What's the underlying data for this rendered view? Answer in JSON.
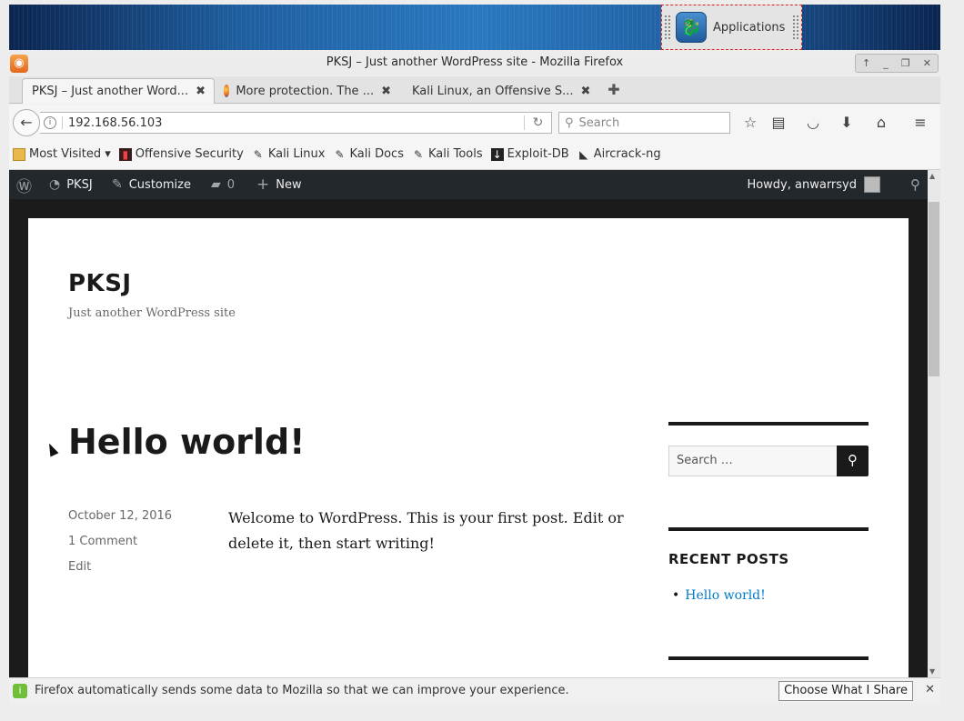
{
  "desktop": {
    "apps_label": "Applications"
  },
  "window": {
    "title": "PKSJ – Just another WordPress site - Mozilla Firefox",
    "controls": [
      "↑",
      "_",
      "❐",
      "✕"
    ]
  },
  "tabs": [
    {
      "label": "PKSJ – Just another Word...",
      "active": true
    },
    {
      "label": "More protection. The ...",
      "active": false
    },
    {
      "label": "Kali Linux, an Offensive S...",
      "active": false
    }
  ],
  "navbar": {
    "url": "192.168.56.103",
    "search_placeholder": "Search"
  },
  "bookmarks": [
    {
      "label": "Most Visited ▾",
      "icon": "folder-icon"
    },
    {
      "label": "Offensive Security",
      "icon": "offsec-icon"
    },
    {
      "label": "Kali Linux",
      "icon": "kali-icon"
    },
    {
      "label": "Kali Docs",
      "icon": "kali-icon"
    },
    {
      "label": "Kali Tools",
      "icon": "kali-icon"
    },
    {
      "label": "Exploit-DB",
      "icon": "exploitdb-icon"
    },
    {
      "label": "Aircrack-ng",
      "icon": "aircrack-icon"
    }
  ],
  "wpbar": {
    "site": "PKSJ",
    "customize": "Customize",
    "comments_count": "0",
    "new": "New",
    "howdy": "Howdy, anwarrsyd"
  },
  "site": {
    "title": "PKSJ",
    "description": "Just another WordPress site"
  },
  "post": {
    "title": "Hello world!",
    "date": "October 12, 2016",
    "comments": "1 Comment",
    "edit": "Edit",
    "body": "Welcome to WordPress. This is your first post. Edit or delete it, then start writing!"
  },
  "sidebar": {
    "search_placeholder": "Search …",
    "recent_posts_title": "RECENT POSTS",
    "recent_posts": [
      "Hello world!"
    ]
  },
  "notification": {
    "text": "Firefox automatically sends some data to Mozilla so that we can improve your experience.",
    "button": "Choose What I Share"
  }
}
